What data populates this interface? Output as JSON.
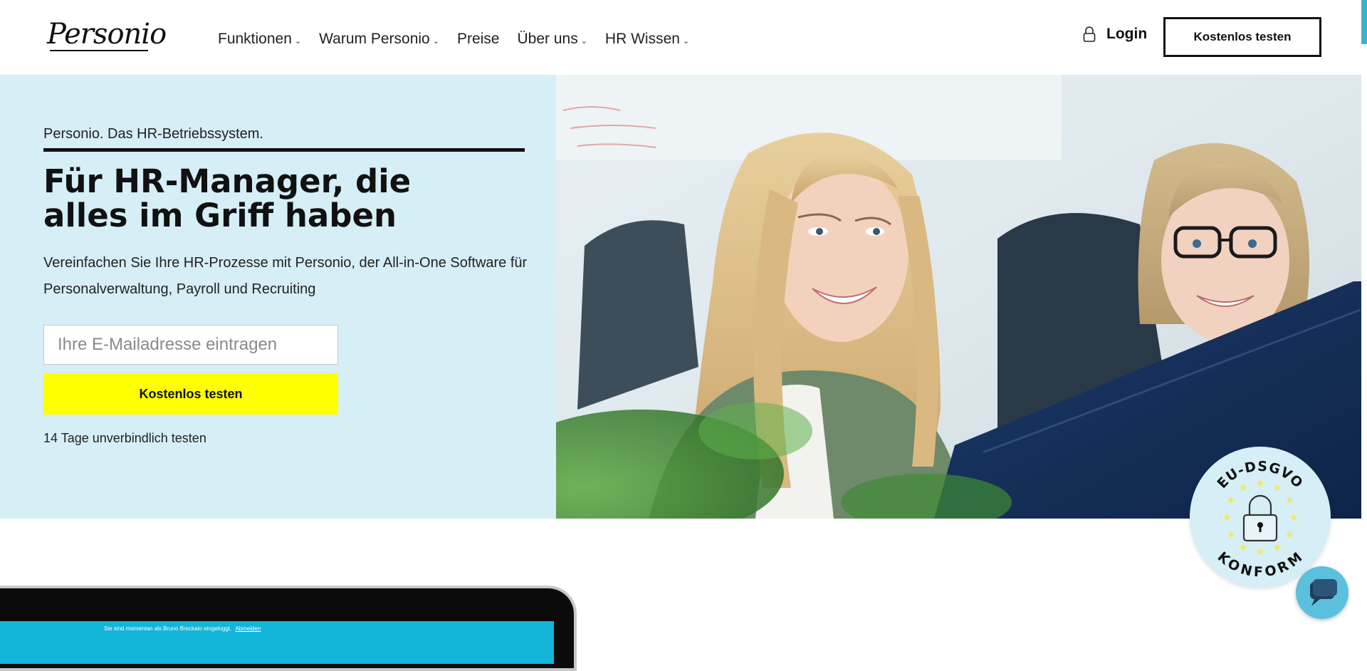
{
  "header": {
    "logo_text": "Personio",
    "nav": [
      {
        "label": "Funktionen",
        "has_dropdown": true
      },
      {
        "label": "Warum Personio",
        "has_dropdown": true
      },
      {
        "label": "Preise",
        "has_dropdown": false
      },
      {
        "label": "Über uns",
        "has_dropdown": true
      },
      {
        "label": "HR Wissen",
        "has_dropdown": true
      }
    ],
    "caret_glyph": "⌄",
    "login_label": "Login",
    "cta_label": "Kostenlos testen"
  },
  "hero": {
    "tagline": "Personio. Das HR-Betriebssystem.",
    "headline": "Für HR-Manager, die alles im Griff haben",
    "subtext": "Vereinfachen Sie Ihre HR-Prozesse mit Personio, der All-in-One Software für Personalverwaltung, Payroll und Recruiting",
    "email_placeholder": "Ihre E-Mailadresse eintragen",
    "email_value": "",
    "cta_label": "Kostenlos testen",
    "trial_note": "14 Tage unverbindlich testen"
  },
  "badge": {
    "top_text": "EU-DSGVO",
    "bottom_text": "KONFORM",
    "icon": "padlock-icon"
  },
  "chat": {
    "icon": "chat-bubble-icon"
  },
  "laptop_preview": {
    "status_text": "Sie sind momentan als Bruno Breckalo eingeloggt.",
    "status_link": "Abmelden"
  },
  "colors": {
    "hero_background": "#d6eef5",
    "cta_yellow": "#ffff00",
    "chat_blue": "#5bc0de",
    "accent_teal": "#3bb3cf",
    "text_dark": "#111111"
  }
}
